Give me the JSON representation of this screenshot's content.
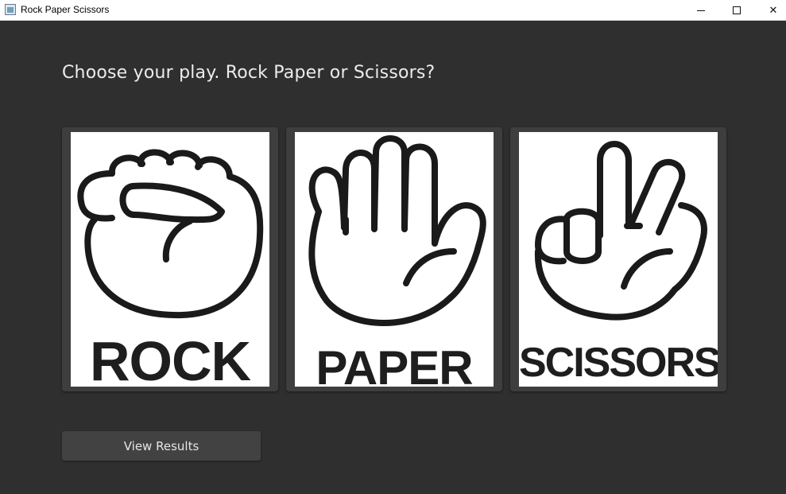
{
  "window": {
    "title": "Rock Paper Scissors",
    "minimize_icon": "minimize-icon",
    "maximize_icon": "maximize-icon",
    "close_icon": "close-icon",
    "close_glyph": "✕"
  },
  "prompt": "Choose your play. Rock Paper or Scissors?",
  "choices": [
    {
      "label": "ROCK",
      "icon": "fist-icon"
    },
    {
      "label": "PAPER",
      "icon": "open-hand-icon"
    },
    {
      "label": "SCISSORS",
      "icon": "peace-hand-icon"
    }
  ],
  "results_button": "View Results",
  "colors": {
    "background": "#2f2f2f",
    "card": "#3e3e3e",
    "button": "#424242",
    "text": "#ececec"
  }
}
